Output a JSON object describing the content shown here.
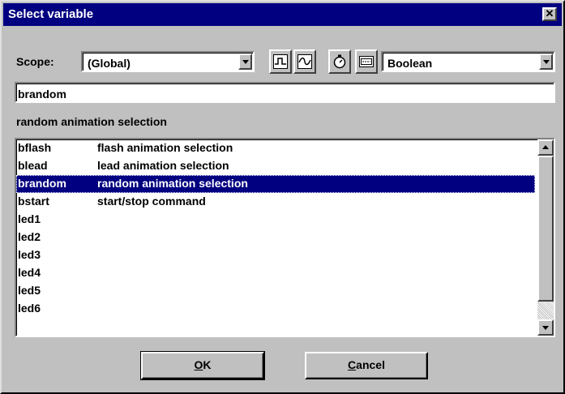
{
  "window": {
    "title": "Select variable"
  },
  "scope": {
    "label": "Scope:",
    "value": "(Global)",
    "type_value": "Boolean",
    "tool_icons": [
      "digital-signal-icon",
      "analog-signal-icon",
      "timer-icon",
      "message-icon"
    ]
  },
  "name_field": {
    "value": "brandom"
  },
  "description": "random animation selection",
  "variables": [
    {
      "name": "bflash",
      "comment": "flash animation selection"
    },
    {
      "name": "blead",
      "comment": "lead animation selection"
    },
    {
      "name": "brandom",
      "comment": "random animation selection",
      "selected": true
    },
    {
      "name": "bstart",
      "comment": "start/stop command"
    },
    {
      "name": "led1",
      "comment": ""
    },
    {
      "name": "led2",
      "comment": ""
    },
    {
      "name": "led3",
      "comment": ""
    },
    {
      "name": "led4",
      "comment": ""
    },
    {
      "name": "led5",
      "comment": ""
    },
    {
      "name": "led6",
      "comment": ""
    }
  ],
  "buttons": {
    "ok": {
      "accel": "O",
      "rest": "K"
    },
    "cancel": {
      "accel": "C",
      "rest": "ancel"
    }
  },
  "colors": {
    "selection": "#000080",
    "face": "#c0c0c0"
  }
}
